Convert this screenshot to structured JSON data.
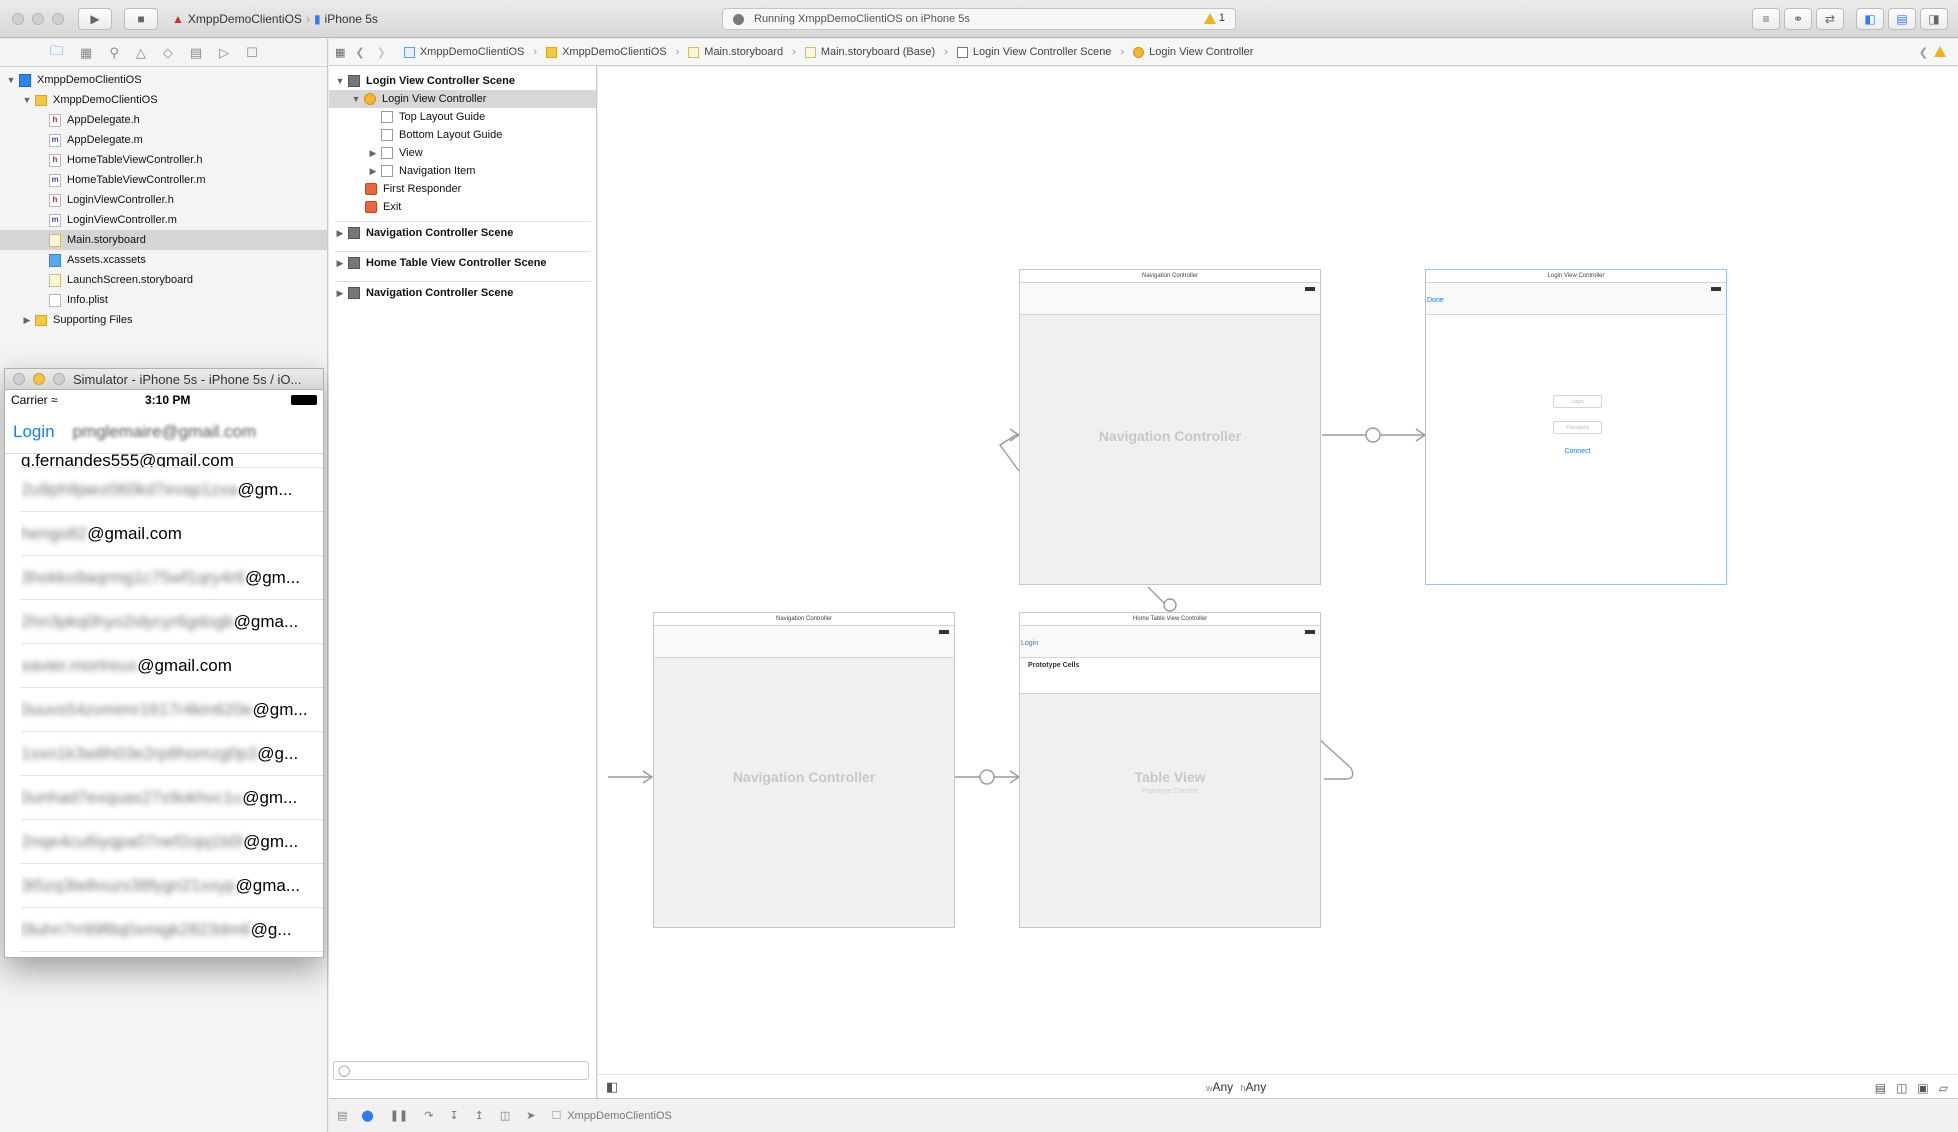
{
  "toolbar": {
    "scheme_app": "XmppDemoClientiOS",
    "scheme_device": "iPhone 5s",
    "status_text": "Running XmppDemoClientiOS on iPhone 5s",
    "warning_count": "1"
  },
  "navigator": {
    "items": [
      {
        "label": "XmppDemoClientiOS",
        "icon": "project"
      },
      {
        "label": "XmppDemoClientiOS",
        "icon": "folder"
      },
      {
        "label": "AppDelegate.h",
        "icon": "h"
      },
      {
        "label": "AppDelegate.m",
        "icon": "m"
      },
      {
        "label": "HomeTableViewController.h",
        "icon": "h"
      },
      {
        "label": "HomeTableViewController.m",
        "icon": "m"
      },
      {
        "label": "LoginViewController.h",
        "icon": "h"
      },
      {
        "label": "LoginViewController.m",
        "icon": "m"
      },
      {
        "label": "Main.storyboard",
        "icon": "storyboard"
      },
      {
        "label": "Assets.xcassets",
        "icon": "assets"
      },
      {
        "label": "LaunchScreen.storyboard",
        "icon": "storyboard"
      },
      {
        "label": "Info.plist",
        "icon": "file"
      },
      {
        "label": "Supporting Files",
        "icon": "folder"
      }
    ]
  },
  "simulator": {
    "title": "Simulator - iPhone 5s - iPhone 5s / iO...",
    "carrier": "Carrier",
    "time": "3:10 PM",
    "nav_left": "Login",
    "nav_email": "pmglemaire@gmail.com",
    "cells": [
      {
        "blur": "",
        "suffix": "g.fernandes555@gmail.com"
      },
      {
        "blur": "2u9ph9jaez060kd7evap1zxa",
        "suffix": "@gm..."
      },
      {
        "blur": "hengo82",
        "suffix": "@gmail.com"
      },
      {
        "blur": "3hokko9aqrmg1c75wf1qry4r6",
        "suffix": "@gm..."
      },
      {
        "blur": "2hn3pkq0hyo2idycyr6gdogb",
        "suffix": "@gma..."
      },
      {
        "blur": "xavier.mortreux",
        "suffix": "@gmail.com"
      },
      {
        "blur": "0uuvs54zvmimr1617r4kin620e",
        "suffix": "@gm..."
      },
      {
        "blur": "1sxn1k3w8h03e2rp8homzg0p3",
        "suffix": "@g..."
      },
      {
        "blur": "0unhad7exquax27x9okhvc1u",
        "suffix": "@gm..."
      },
      {
        "blur": "2nqe4cu6iyqpa07nef2ojq1b0l",
        "suffix": "@gm..."
      },
      {
        "blur": "3t5zq3te8vuzs38fygri21xxyp",
        "suffix": "@gma..."
      },
      {
        "blur": "0luhn7rr99f8q0xmigk2823dm6",
        "suffix": "@g..."
      }
    ]
  },
  "jump_bar": {
    "crumbs": [
      "XmppDemoClientiOS",
      "XmppDemoClientiOS",
      "Main.storyboard",
      "Main.storyboard (Base)",
      "Login View Controller Scene",
      "Login View Controller"
    ]
  },
  "outline": {
    "scene1": "Login View Controller Scene",
    "vc": "Login View Controller",
    "top_guide": "Top Layout Guide",
    "bottom_guide": "Bottom Layout Guide",
    "view": "View",
    "nav_item": "Navigation Item",
    "first_responder": "First Responder",
    "exit": "Exit",
    "scene2": "Navigation Controller Scene",
    "scene3": "Home Table View Controller Scene",
    "scene4": "Navigation Controller Scene"
  },
  "canvas": {
    "nav1_title": "Navigation Controller",
    "nav1_label": "Navigation Controller",
    "login_title": "Login View Controller",
    "login_done": "Done",
    "login_field": "Login",
    "password_field": "Password",
    "connect": "Connect",
    "nav2_title": "Navigation Controller",
    "nav2_label": "Navigation Controller",
    "home_title": "Home Table View Controller",
    "home_nav_login": "Login",
    "prototype_cells": "Prototype Cells",
    "table_view": "Table View",
    "prototype_content": "Prototype Content"
  },
  "size_class": {
    "w_prefix": "w",
    "w_value": "Any",
    "h_prefix": "h",
    "h_value": "Any"
  },
  "debug": {
    "target": "XmppDemoClientiOS"
  }
}
